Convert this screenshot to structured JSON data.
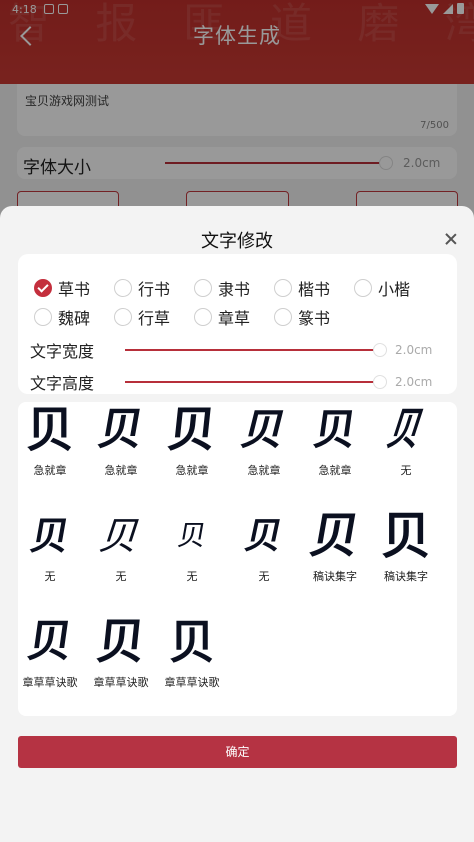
{
  "status_bar": {
    "time": "4:18"
  },
  "header": {
    "title": "字体生成",
    "background_chars": "智 报 匪 道 磨 湾 行 府 犊"
  },
  "input": {
    "text": "宝贝游戏网测试",
    "counter": "7/500"
  },
  "font_size": {
    "label": "字体大小",
    "value": "2.0cm"
  },
  "sheet": {
    "title": "文字修改",
    "styles": [
      {
        "label": "草书",
        "checked": true
      },
      {
        "label": "行书",
        "checked": false
      },
      {
        "label": "隶书",
        "checked": false
      },
      {
        "label": "楷书",
        "checked": false
      },
      {
        "label": "小楷",
        "checked": false
      },
      {
        "label": "魏碑",
        "checked": false
      },
      {
        "label": "行草",
        "checked": false
      },
      {
        "label": "章草",
        "checked": false
      },
      {
        "label": "篆书",
        "checked": false
      }
    ],
    "width": {
      "label": "文字宽度",
      "value": "2.0cm"
    },
    "height": {
      "label": "文字高度",
      "value": "2.0cm"
    },
    "glyph_char": "贝",
    "glyphs": [
      {
        "caption": "急就章"
      },
      {
        "caption": "急就章"
      },
      {
        "caption": "急就章"
      },
      {
        "caption": "急就章"
      },
      {
        "caption": "急就章"
      },
      {
        "caption": "无"
      },
      {
        "caption": "无"
      },
      {
        "caption": "无"
      },
      {
        "caption": "无"
      },
      {
        "caption": "无"
      },
      {
        "caption": "稿诀集字"
      },
      {
        "caption": "稿诀集字"
      },
      {
        "caption": "章草草诀歌"
      },
      {
        "caption": "章草草诀歌"
      },
      {
        "caption": "章草草诀歌"
      }
    ],
    "confirm_label": "确定"
  },
  "colors": {
    "header_red": "#c0302c",
    "accent_red": "#b53343"
  }
}
